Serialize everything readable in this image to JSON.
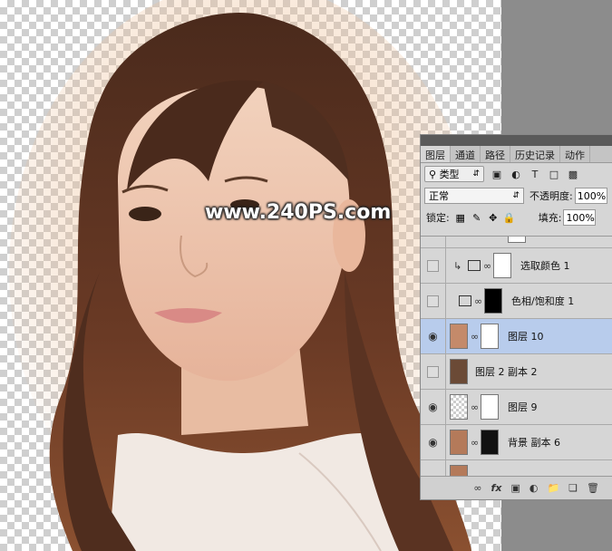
{
  "watermark": "www.240PS.com",
  "panel": {
    "tabs": [
      "图层",
      "通道",
      "路径",
      "历史记录",
      "动作"
    ],
    "filter_kind": "类型",
    "blend_mode": "正常",
    "opacity_label": "不透明度:",
    "opacity_value": "100%",
    "lock_label": "锁定:",
    "fill_label": "填充:",
    "fill_value": "100%",
    "layers": [
      {
        "name": "选取颜色 1",
        "visible": false
      },
      {
        "name": "色相/饱和度 1",
        "visible": false
      },
      {
        "name": "图层 10",
        "visible": true,
        "selected": true
      },
      {
        "name": "图层 2 副本 2",
        "visible": false
      },
      {
        "name": "图层 9",
        "visible": true
      },
      {
        "name": "背景 副本 6",
        "visible": true
      }
    ],
    "bottom_icons": [
      "link-icon",
      "fx-icon",
      "mask-icon",
      "adjustment-icon",
      "folder-icon",
      "new-layer-icon",
      "trash-icon"
    ]
  },
  "colors": {
    "selected_row": "#b8ccec",
    "hair_brown": "#5a3222",
    "layer_fill_brown": "#6b4a36"
  }
}
